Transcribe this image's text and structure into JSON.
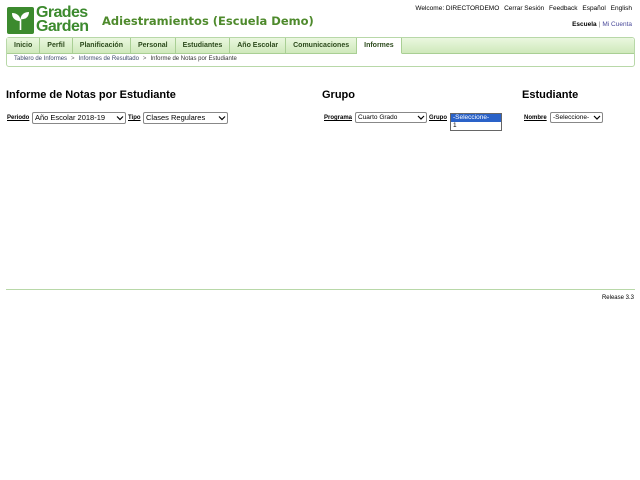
{
  "brand": {
    "logo_line1": "Grades",
    "logo_line2": "Garden",
    "app_title": "Adiestramientos (Escuela Demo)",
    "accent_color": "#3c8a2e",
    "icon": "plant-leaf-icon"
  },
  "top_links": {
    "welcome": "Welcome: DIRECTORDEMO",
    "logout": "Cerrar Sesión",
    "feedback": "Feedback",
    "espanol": "Español",
    "english": "English"
  },
  "context": {
    "escuela": "Escuela",
    "separator": "|",
    "mi_cuenta": "Mi Cuenta"
  },
  "nav": {
    "tabs": [
      {
        "label": "Inicio"
      },
      {
        "label": "Perfil"
      },
      {
        "label": "Planificación"
      },
      {
        "label": "Personal"
      },
      {
        "label": "Estudiantes"
      },
      {
        "label": "Año Escolar"
      },
      {
        "label": "Comunicaciones"
      },
      {
        "label": "Informes",
        "active": true
      }
    ]
  },
  "breadcrumb": {
    "items": [
      "Tablero de Informes",
      "Informes de Resultado",
      "Informe de Notas por Estudiante"
    ]
  },
  "report": {
    "title": "Informe de Notas por Estudiante",
    "periodo_label": "Periodo",
    "periodo_value": "Año Escolar 2018-19",
    "tipo_label": "Tipo",
    "tipo_value": "Clases Regulares"
  },
  "grupo": {
    "title": "Grupo",
    "programa_label": "Programa",
    "programa_value": "Cuarto Grado",
    "grupo_label": "Grupo",
    "grupo_options": [
      "-Seleccione-",
      "1"
    ],
    "grupo_selected": "-Seleccione-"
  },
  "estudiante": {
    "title": "Estudiante",
    "nombre_label": "Nombre",
    "nombre_value": "-Seleccione-"
  },
  "footer": {
    "release": "Release 3.3"
  }
}
